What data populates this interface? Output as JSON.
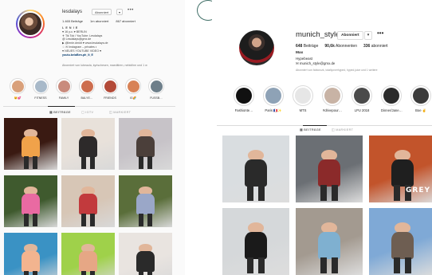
{
  "left_profile": {
    "username": "lesdalays",
    "button_label": "Abonniert",
    "dropdown_label": "▾",
    "more_label": "•••",
    "stats": [
      "1.465 Beiträge",
      "1m abonniert",
      "867 abonniert"
    ],
    "bio_lines": [
      "L E N I E",
      "♥ 16 y.o. ♥ BERLIN",
      "✈ Tik Tok / YouTube: Lesdalays",
      "@ Lesdalays@gmx.de",
      "▶ @lenie.dmidt ♥ www.lesdalays.de",
      "☆ ✉ Instagram – privates ◐",
      "♥ NEUES YOUTUBE VIDEO ♥"
    ],
    "bio_link": "youtu.be/aBen-ph_It_E",
    "followed_by": "Abonniert von lubeaula, kyrischesen, maeditiren, nebidihm und 1 w",
    "highlights": [
      {
        "label": "🐱💕",
        "color": "#d9a07a"
      },
      {
        "label": "FITNESS",
        "color": "#a8b9c9"
      },
      {
        "label": "FAMILY",
        "color": "#c98b7d"
      },
      {
        "label": "BALYE…",
        "color": "#cd6d4e"
      },
      {
        "label": "FRIENDS",
        "color": "#b34a38"
      },
      {
        "label": "IG🌈",
        "color": "#d88256"
      },
      {
        "label": "FUSSB…",
        "color": "#6e7f8a"
      }
    ],
    "tabs": [
      {
        "label": "▦ BEITRÄGE"
      },
      {
        "label": "▢ IGTV"
      },
      {
        "label": "◫ MARKIERT"
      }
    ],
    "posts": [
      {
        "bg": "#3a1a12",
        "accent": "#f0a24a"
      },
      {
        "bg": "#e8e1da",
        "accent": "#2d2a2a"
      },
      {
        "bg": "#c7c3c8",
        "accent": "#4b3f3a"
      },
      {
        "bg": "#3f5a2e",
        "accent": "#e96aa2"
      },
      {
        "bg": "#d7c6b6",
        "accent": "#c23a3d"
      },
      {
        "bg": "#5a6e3a",
        "accent": "#9aa7c8"
      },
      {
        "bg": "#3a92c4",
        "accent": "#f2b48f"
      },
      {
        "bg": "#9fd14a",
        "accent": "#e6a785"
      },
      {
        "bg": "#e9e4e0",
        "accent": "#2a2a2a"
      }
    ]
  },
  "right_profile": {
    "username": "munich_style",
    "button_label": "Abonniert",
    "dropdown_label": "▾",
    "more_label": "•••",
    "stats": [
      {
        "value": "648",
        "label": "Beiträge"
      },
      {
        "value": "90,6k",
        "label": "Abonnenten"
      },
      {
        "value": "336",
        "label": "abonniert"
      }
    ],
    "name": "Max",
    "bio_lines": [
      "Hypebeast",
      "✉ munich_style@gmx.de"
    ],
    "followed_by": "Abonniert von fabiorozk, totallyoverhyped, hyped.juice und 1 weitere",
    "highlights": [
      {
        "label": "Fashionte…",
        "color": "#111111"
      },
      {
        "label": "Paris 🇫🇷✨",
        "color": "#8ea2b6"
      },
      {
        "label": "MTS",
        "color": "#e6e6e6"
      },
      {
        "label": "#drivepour…",
        "color": "#c8b3a5"
      },
      {
        "label": "LPU 2018",
        "color": "#4a4a4a"
      },
      {
        "label": "Dinner/Jane…",
        "color": "#2b2b2b"
      },
      {
        "label": "Boe ✌",
        "color": "#3a3a3a"
      }
    ],
    "tabs": [
      {
        "label": "▦ BEITRÄGE"
      },
      {
        "label": "◫ MARKIERT"
      }
    ],
    "posts": [
      {
        "bg": "#d9dde0",
        "accent": "#2a2a2a"
      },
      {
        "bg": "#6b6f74",
        "accent": "#8b2a2a"
      },
      {
        "bg": "#c2542b",
        "accent": "#1f1f1f"
      },
      {
        "bg": "#d5d8da",
        "accent": "#1a1a1a"
      },
      {
        "bg": "#a39a90",
        "accent": "#7fb0d0"
      },
      {
        "bg": "#7fa9d6",
        "accent": "#6e5e52"
      }
    ],
    "post_caption": "GREY"
  }
}
